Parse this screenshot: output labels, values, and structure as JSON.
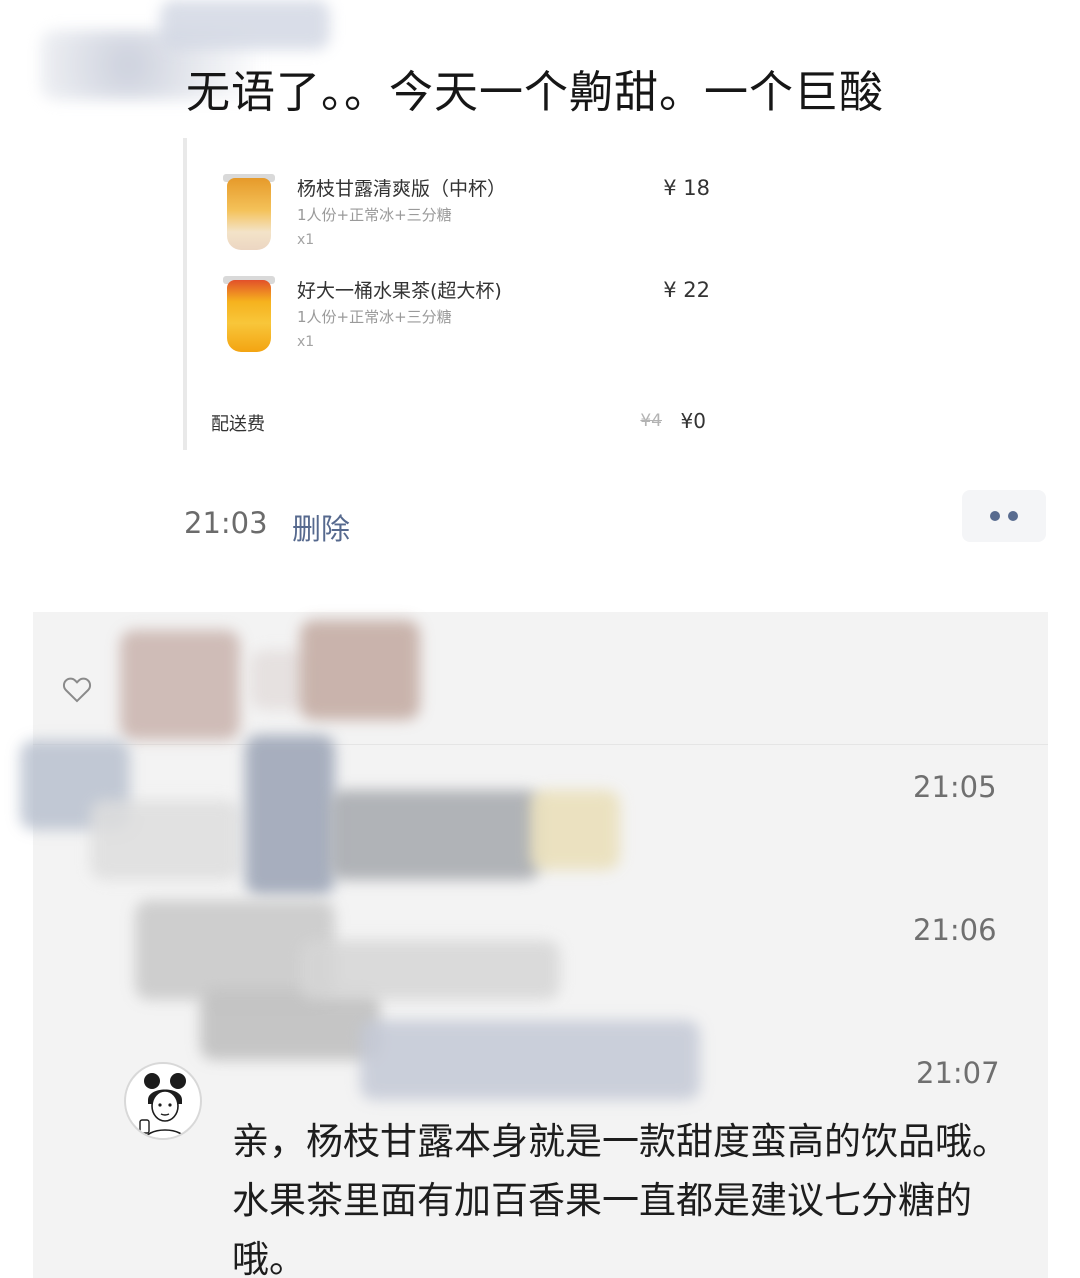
{
  "post": {
    "text": "无语了。。今天一个齁甜。一个巨酸",
    "time": "21:03",
    "delete_label": "删除"
  },
  "order": {
    "items": [
      {
        "name": "杨枝甘露清爽版（中杯）",
        "spec": "1人份+正常冰+三分糖",
        "qty": "x1",
        "price": "¥ 18",
        "thumb_icon": "drink-cup-icon"
      },
      {
        "name": "好大一桶水果茶(超大杯)",
        "spec": "1人份+正常冰+三分糖",
        "qty": "x1",
        "price": "¥ 22",
        "thumb_icon": "drink-bucket-icon"
      }
    ],
    "delivery": {
      "label": "配送费",
      "original": "¥4",
      "current": "¥0"
    }
  },
  "comments": {
    "times": [
      "21:05",
      "21:06",
      "21:07"
    ],
    "reply": "亲，杨枝甘露本身就是一款甜度蛮高的饮品哦。水果茶里面有加百香果一直都是建议七分糖的哦。"
  },
  "icons": {
    "like": "heart-icon",
    "more": "more-icon"
  },
  "colors": {
    "link": "#56698e",
    "comment_bg": "#f3f3f3"
  }
}
